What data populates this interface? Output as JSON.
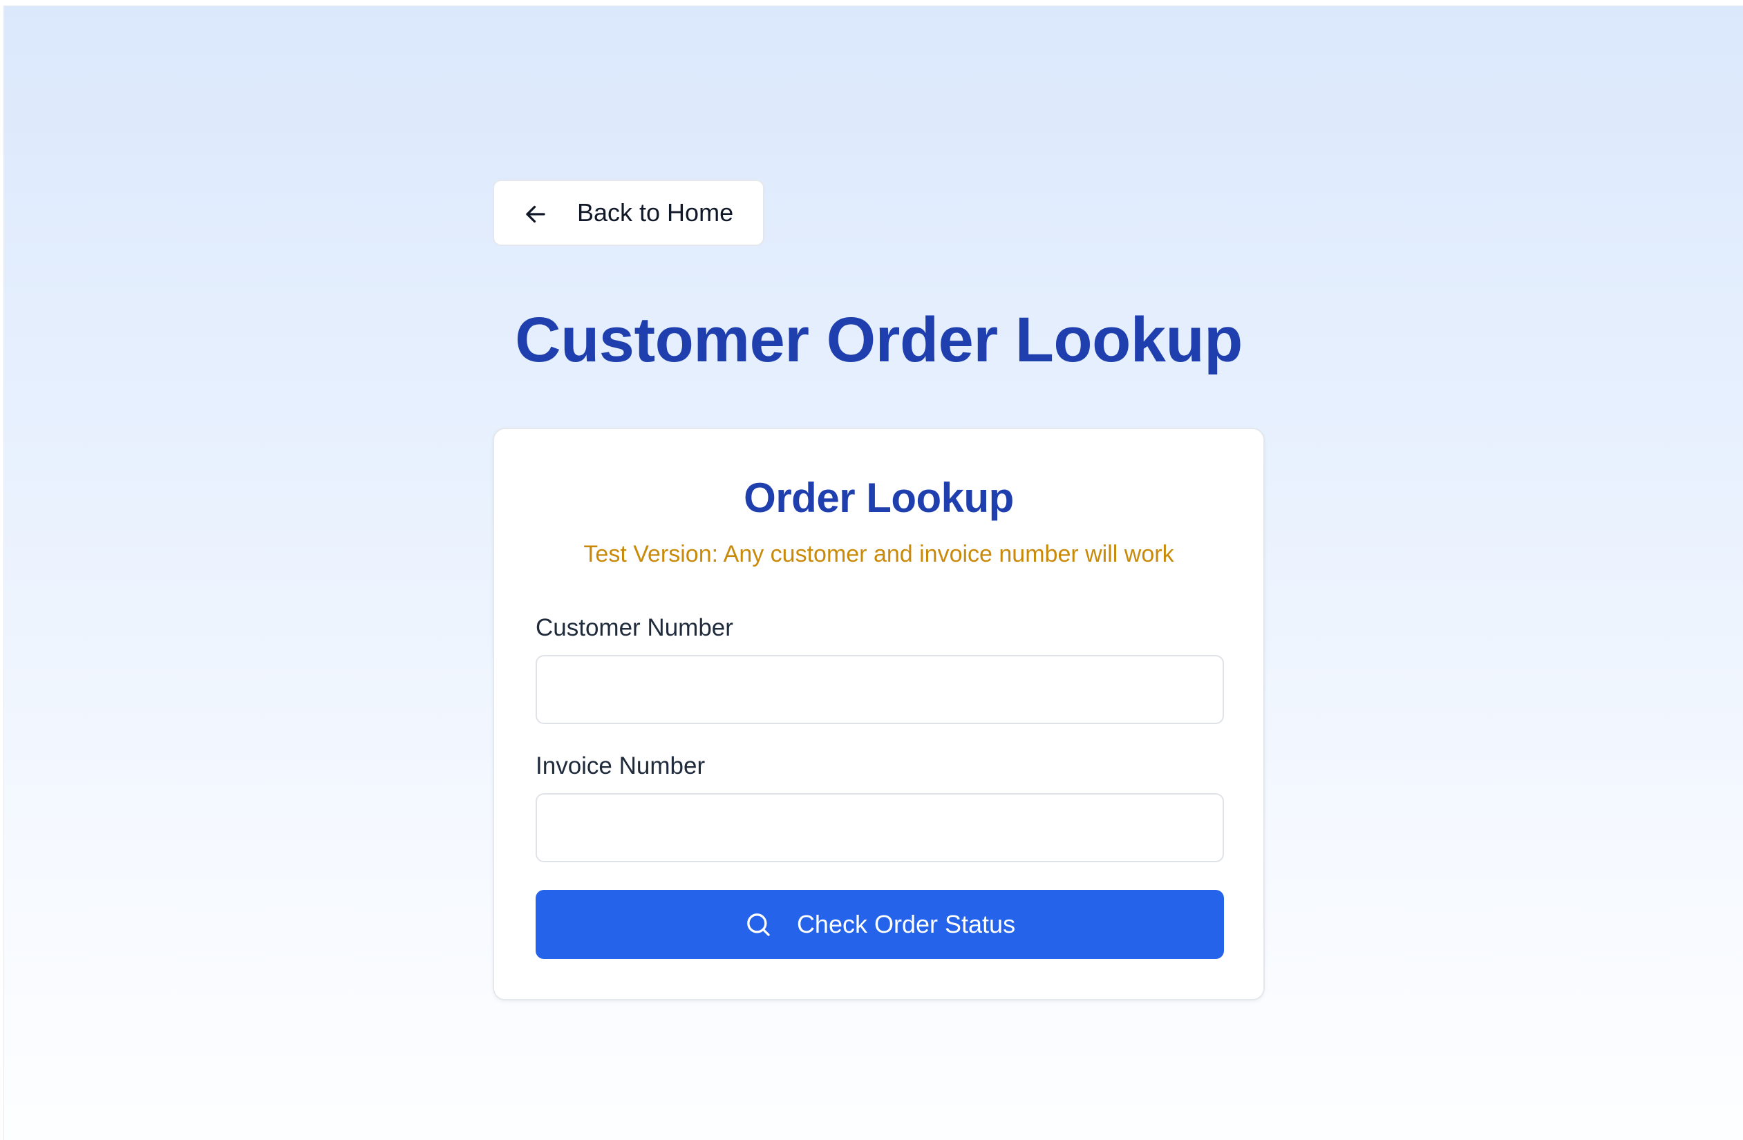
{
  "nav": {
    "back_label": "Back to Home",
    "back_icon": "arrow-left-icon"
  },
  "header": {
    "title": "Customer Order Lookup"
  },
  "form": {
    "title": "Order Lookup",
    "note": "Test Version: Any customer and invoice number will work",
    "customer_label": "Customer Number",
    "customer_value": "",
    "customer_placeholder": "",
    "invoice_label": "Invoice Number",
    "invoice_value": "",
    "invoice_placeholder": "",
    "submit_label": "Check Order Status",
    "submit_icon": "search-icon"
  },
  "colors": {
    "title": "#1e3fad",
    "note": "#c98a0a",
    "button": "#2563eb",
    "background_top": "#dbe8fc",
    "background_bottom": "#fdfeff"
  }
}
